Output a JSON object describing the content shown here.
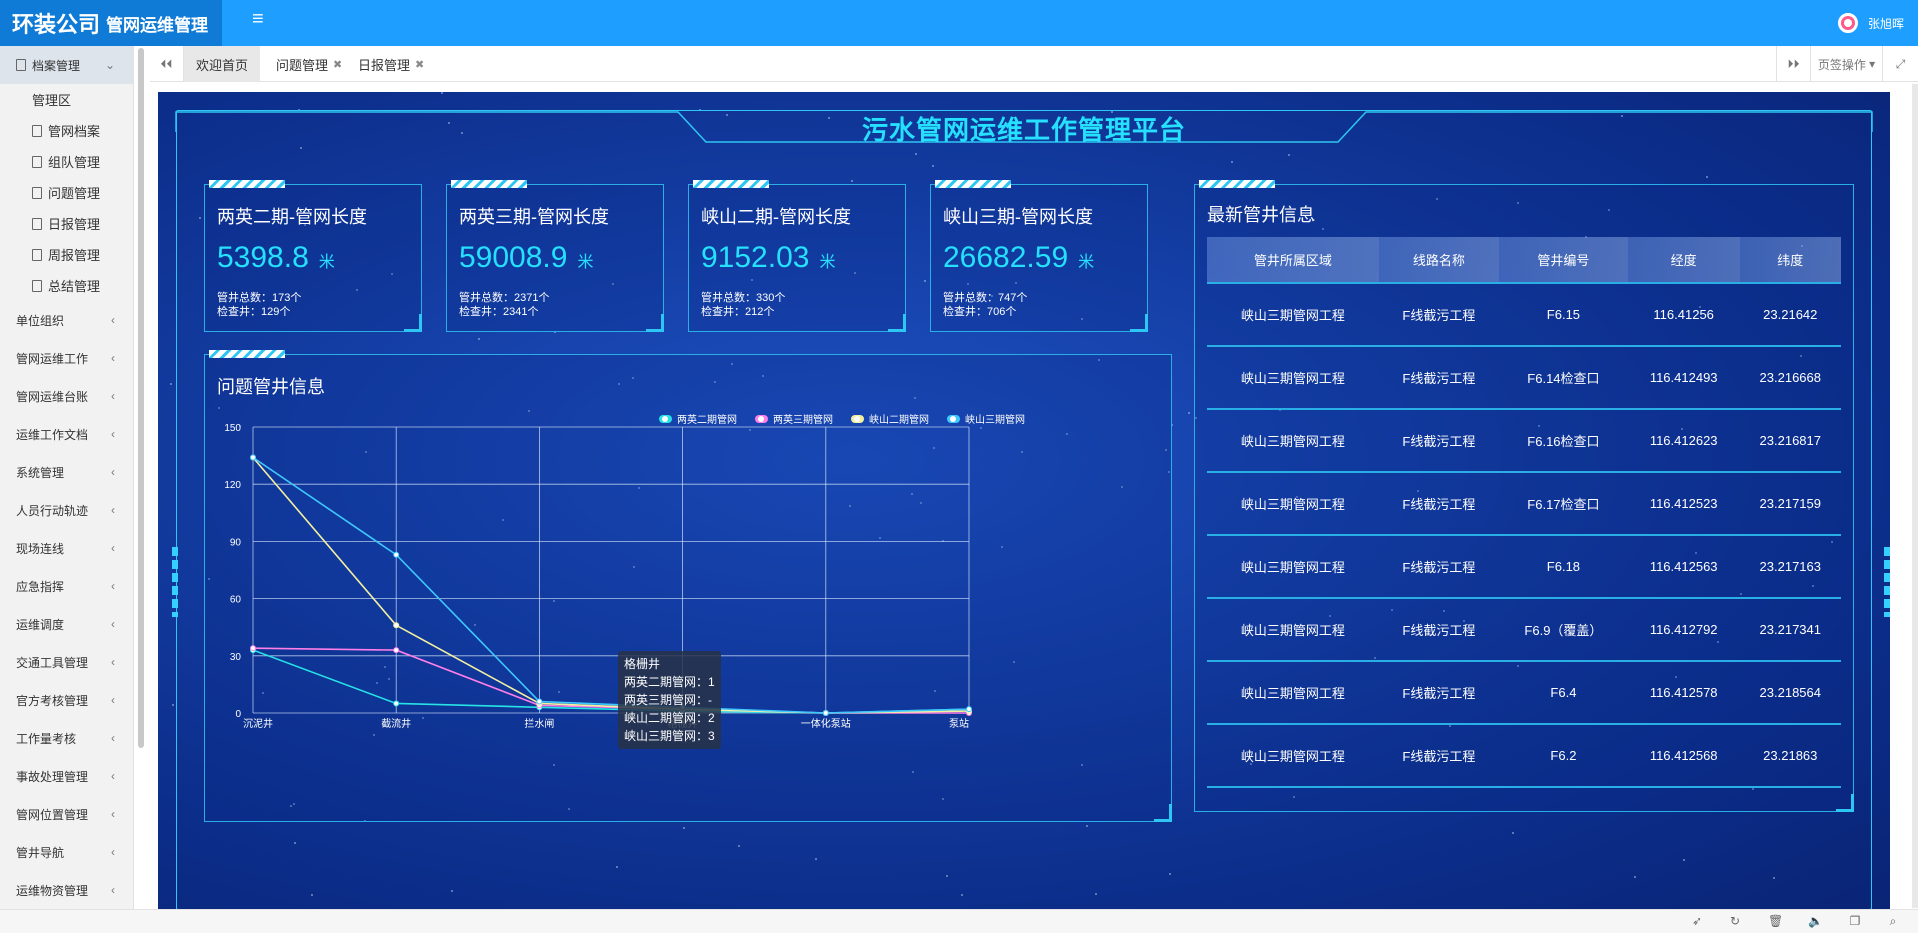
{
  "header": {
    "company": "环装公司",
    "system": "管网运维管理",
    "menu_icon": "≡",
    "user_name": "张旭晖"
  },
  "sidebar": {
    "top": {
      "label": "档案管理",
      "icon": "document-icon"
    },
    "sub_items": [
      {
        "label": "管理区"
      },
      {
        "label": "管网档案"
      },
      {
        "label": "组队管理"
      },
      {
        "label": "问题管理"
      },
      {
        "label": "日报管理"
      },
      {
        "label": "周报管理"
      },
      {
        "label": "总结管理"
      }
    ],
    "items": [
      {
        "label": "单位组织"
      },
      {
        "label": "管网运维工作"
      },
      {
        "label": "管网运维台账"
      },
      {
        "label": "运维工作文档"
      },
      {
        "label": "系统管理"
      },
      {
        "label": "人员行动轨迹"
      },
      {
        "label": "现场连线"
      },
      {
        "label": "应急指挥"
      },
      {
        "label": "运维调度"
      },
      {
        "label": "交通工具管理"
      },
      {
        "label": "官方考核管理"
      },
      {
        "label": "工作量考核"
      },
      {
        "label": "事故处理管理"
      },
      {
        "label": "管网位置管理"
      },
      {
        "label": "管井导航"
      },
      {
        "label": "运维物资管理"
      }
    ]
  },
  "tabs": {
    "items": [
      {
        "label": "欢迎首页"
      },
      {
        "label": "问题管理"
      },
      {
        "label": "日报管理"
      }
    ],
    "close_glyph": "✖",
    "tab_ops": "页签操作"
  },
  "dashboard": {
    "title": "污水管网运维工作管理平台",
    "stats": [
      {
        "title": "两英二期-管网长度",
        "value": "5398.8",
        "unit": "米",
        "wells": "管井总数：173个",
        "checks": "检查井：129个"
      },
      {
        "title": "两英三期-管网长度",
        "value": "59008.9",
        "unit": "米",
        "wells": "管井总数：2371个",
        "checks": "检查井：2341个"
      },
      {
        "title": "峡山二期-管网长度",
        "value": "9152.03",
        "unit": "米",
        "wells": "管井总数：330个",
        "checks": "检查井：212个"
      },
      {
        "title": "峡山三期-管网长度",
        "value": "26682.59",
        "unit": "米",
        "wells": "管井总数：747个",
        "checks": "检查井：706个"
      }
    ],
    "latest": {
      "title": "最新管井信息",
      "columns": [
        "管井所属区域",
        "线路名称",
        "管井编号",
        "经度",
        "纬度"
      ],
      "rows": [
        [
          "峡山三期管网工程",
          "F线截污工程",
          "F6.15",
          "116.41256",
          "23.21642"
        ],
        [
          "峡山三期管网工程",
          "F线截污工程",
          "F6.14检查口",
          "116.412493",
          "23.216668"
        ],
        [
          "峡山三期管网工程",
          "F线截污工程",
          "F6.16检查口",
          "116.412623",
          "23.216817"
        ],
        [
          "峡山三期管网工程",
          "F线截污工程",
          "F6.17检查口",
          "116.412523",
          "23.217159"
        ],
        [
          "峡山三期管网工程",
          "F线截污工程",
          "F6.18",
          "116.412563",
          "23.217163"
        ],
        [
          "峡山三期管网工程",
          "F线截污工程",
          "F6.9（覆盖）",
          "116.412792",
          "23.217341"
        ],
        [
          "峡山三期管网工程",
          "F线截污工程",
          "F6.4",
          "116.412578",
          "23.218564"
        ],
        [
          "峡山三期管网工程",
          "F线截污工程",
          "F6.2",
          "116.412568",
          "23.21863"
        ]
      ]
    },
    "problem": {
      "title": "问题管井信息"
    },
    "tooltip": {
      "title": "格栅井",
      "lines": [
        "两英二期管网：1",
        "两英三期管网：-",
        "峡山二期管网：2",
        "峡山三期管网：3"
      ]
    }
  },
  "chart_data": {
    "type": "line",
    "categories": [
      "沉泥井",
      "截流井",
      "拦水闸",
      "格栅井",
      "一体化泵站",
      "泵站"
    ],
    "ylim": [
      0,
      150
    ],
    "yticks": [
      0,
      30,
      60,
      90,
      120,
      150
    ],
    "legend_position": "top-center",
    "series": [
      {
        "name": "两英二期管网",
        "color": "#27e3e6",
        "values": [
          33,
          5,
          3,
          1,
          0,
          2
        ]
      },
      {
        "name": "两英三期管网",
        "color": "#ff7ee8",
        "values": [
          34,
          33,
          4,
          null,
          0,
          0
        ]
      },
      {
        "name": "峡山二期管网",
        "color": "#f3f0a0",
        "values": [
          134,
          46,
          5,
          2,
          0,
          1
        ]
      },
      {
        "name": "峡山三期管网",
        "color": "#3fc8ff",
        "values": [
          134,
          83,
          6,
          3,
          0,
          2
        ]
      }
    ]
  }
}
